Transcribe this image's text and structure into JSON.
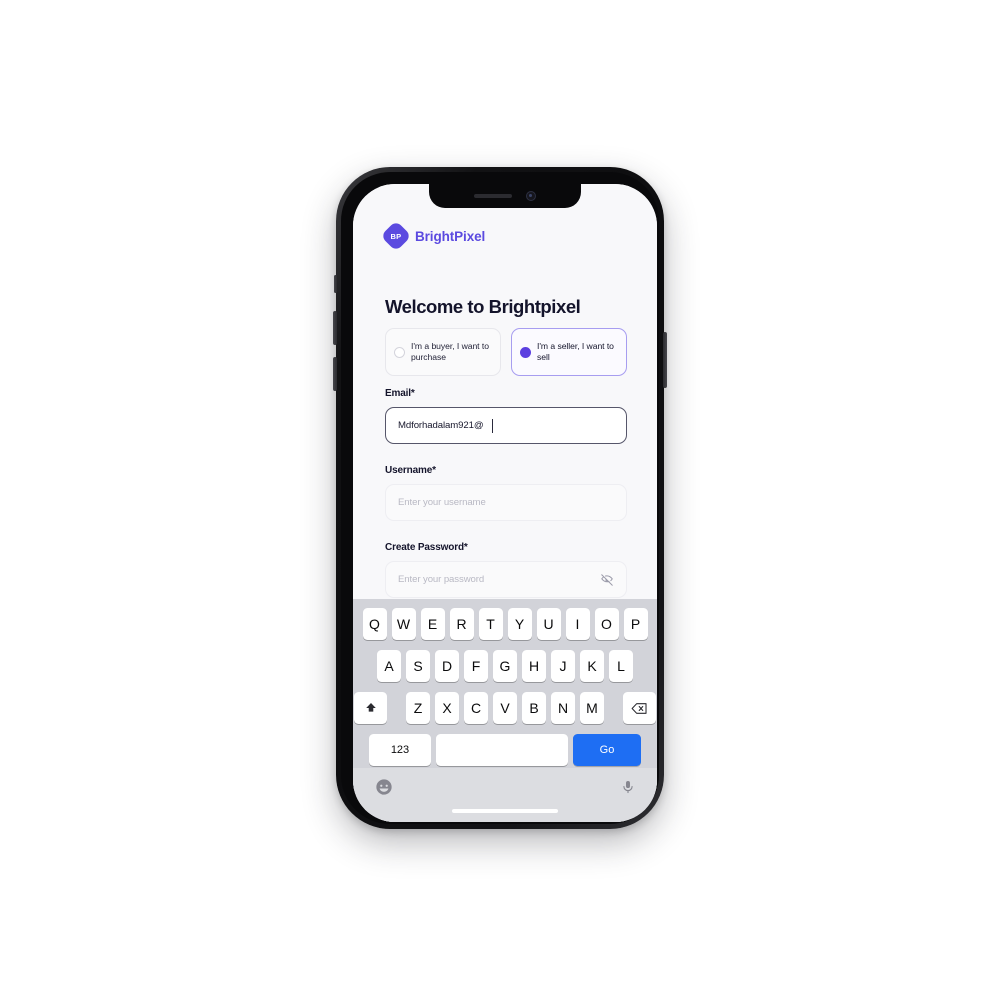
{
  "brand": {
    "mark_text": "BP",
    "name": "BrightPixel",
    "accent_color": "#5b4ae0"
  },
  "page": {
    "title": "Welcome to Brightpixel"
  },
  "roles": [
    {
      "label": "I'm a buyer, I want to purchase",
      "selected": false
    },
    {
      "label": "I'm a seller, I want to sell",
      "selected": true
    }
  ],
  "fields": {
    "email": {
      "label": "Email*",
      "value": "Mdforhadalam921@",
      "placeholder": "Enter your email",
      "state": "active"
    },
    "username": {
      "label": "Username*",
      "value": "",
      "placeholder": "Enter your username",
      "state": "idle"
    },
    "password": {
      "label": "Create Password*",
      "value": "",
      "placeholder": "Enter your password",
      "state": "idle",
      "toggle_icon": "eye-off-icon"
    }
  },
  "keyboard": {
    "row1": [
      "Q",
      "W",
      "E",
      "R",
      "T",
      "Y",
      "U",
      "I",
      "O",
      "P"
    ],
    "row2": [
      "A",
      "S",
      "D",
      "F",
      "G",
      "H",
      "J",
      "K",
      "L"
    ],
    "row3": [
      "Z",
      "X",
      "C",
      "V",
      "B",
      "N",
      "M"
    ],
    "shift_icon": "shift-arrow-icon",
    "backspace_icon": "backspace-icon",
    "numeric_label": "123",
    "space_label": "",
    "action_label": "Go",
    "emoji_icon": "emoji-smiley-icon",
    "mic_icon": "microphone-icon",
    "action_color": "#1e6ef3",
    "background_color": "#d2d3d9"
  },
  "device": {
    "notch_speaker": "speaker-grille",
    "notch_camera": "front-camera",
    "home_indicator": "home-indicator-bar",
    "buttons": [
      "mute-switch",
      "volume-up",
      "volume-down",
      "power"
    ]
  }
}
